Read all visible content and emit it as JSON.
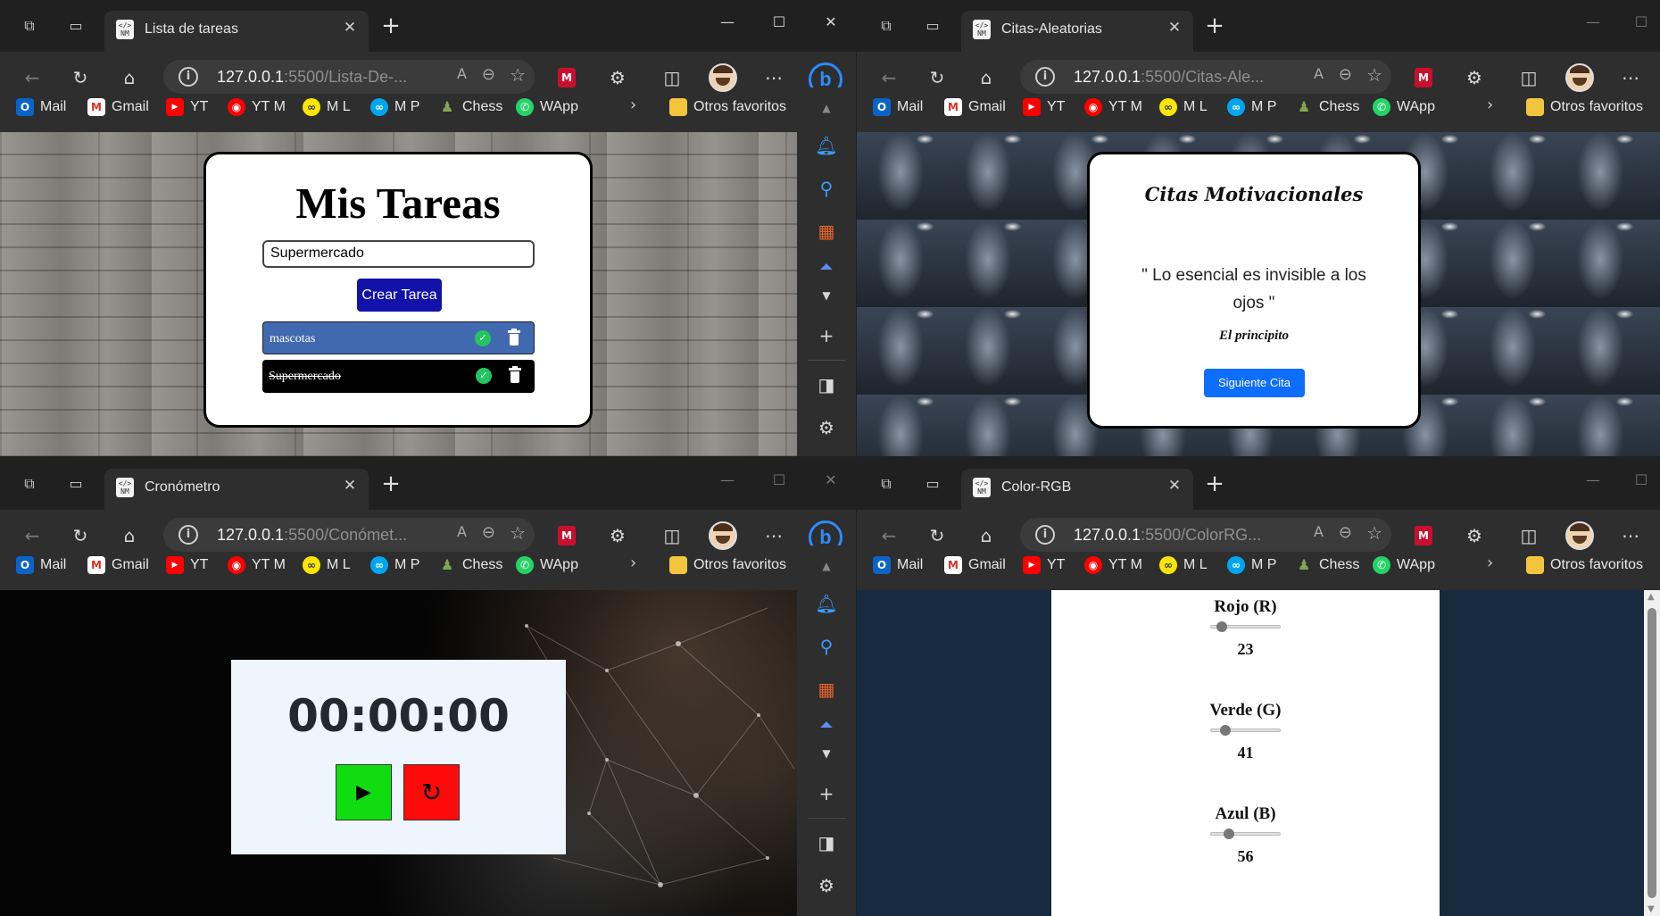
{
  "bookmarks": [
    {
      "label": "Mail",
      "icon": "outlook-icon",
      "color": "#0a64c8",
      "glyph": "O"
    },
    {
      "label": "Gmail",
      "icon": "gmail-icon",
      "color": "#d93025",
      "glyph": "M"
    },
    {
      "label": "YT",
      "icon": "youtube-icon",
      "color": "#ff0000",
      "glyph": "▶"
    },
    {
      "label": "YT M",
      "icon": "youtube-music-icon",
      "color": "#ff0000",
      "glyph": "◉"
    },
    {
      "label": "M L",
      "icon": "mercadolibre-icon",
      "color": "#ffe600",
      "glyph": "∞"
    },
    {
      "label": "M P",
      "icon": "mercadopago-icon",
      "color": "#00a6f0",
      "glyph": "∞"
    },
    {
      "label": "Chess",
      "icon": "chess-pawn-icon",
      "color": "#7fa650",
      "glyph": "♟"
    },
    {
      "label": "WApp",
      "icon": "whatsapp-icon",
      "color": "#25d366",
      "glyph": "✆"
    }
  ],
  "other_favorites": "Otros favoritos",
  "windows": {
    "todo": {
      "tab_title": "Lista de tareas",
      "url_host": "127.0.0.1",
      "url_rest": ":5500/Lista-De-...",
      "heading": "Mis Tareas",
      "input_value": "Supermercado",
      "create_button": "Crear Tarea",
      "tasks": [
        {
          "text": "mascotas",
          "done": false,
          "bg": "#4169b0"
        },
        {
          "text": "Supermercado",
          "done": true,
          "bg": "#000000"
        }
      ]
    },
    "quotes": {
      "tab_title": "Citas-Aleatorias",
      "url_host": "127.0.0.1",
      "url_rest": ":5500/Citas-Ale...",
      "heading": "Citas Motivacionales",
      "quote": "\" Lo esencial es invisible a los ojos \"",
      "author": "El principito",
      "next_button": "Siguiente Cita"
    },
    "stopwatch": {
      "tab_title": "Cronómetro",
      "url_host": "127.0.0.1",
      "url_rest": ":5500/Conómet...",
      "time": "00:00:00",
      "play_color": "#10dd10",
      "reset_color": "#ff0a0a"
    },
    "rgb": {
      "tab_title": "Color-RGB",
      "url_host": "127.0.0.1",
      "url_rest": ":5500/ColorRG...",
      "page_bg": "#172a3e",
      "sliders": [
        {
          "label": "Rojo (R)",
          "value": "23",
          "fraction": 0.09
        },
        {
          "label": "Verde (G)",
          "value": "41",
          "fraction": 0.16
        },
        {
          "label": "Azul (B)",
          "value": "56",
          "fraction": 0.22
        }
      ]
    }
  }
}
